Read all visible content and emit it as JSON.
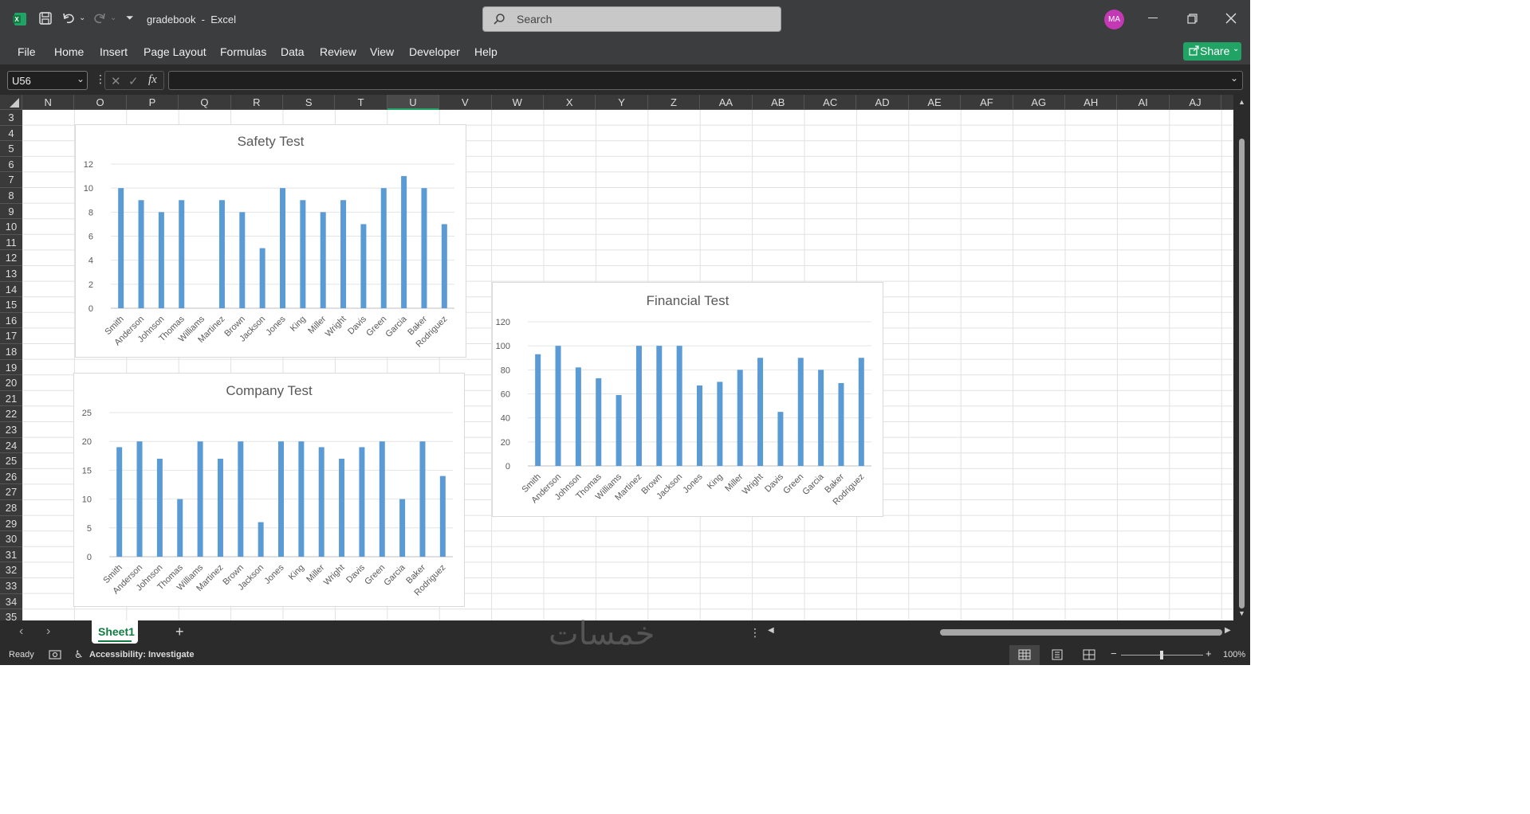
{
  "titlebar": {
    "doc_title": "gradebook  -  Excel",
    "search_placeholder": "Search",
    "avatar_initials": "MA"
  },
  "ribbon": {
    "tabs": [
      "File",
      "Home",
      "Insert",
      "Page Layout",
      "Formulas",
      "Data",
      "Review",
      "View",
      "Developer",
      "Help"
    ],
    "share_label": "Share"
  },
  "formula_bar": {
    "name_box": "U56",
    "fx_label": "fx",
    "formula": ""
  },
  "columns": [
    "N",
    "O",
    "P",
    "Q",
    "R",
    "S",
    "T",
    "U",
    "V",
    "W",
    "X",
    "Y",
    "Z",
    "AA",
    "AB",
    "AC",
    "AD",
    "AE",
    "AF",
    "AG",
    "AH",
    "AI",
    "AJ"
  ],
  "selected_column": "U",
  "rows": [
    "3",
    "4",
    "5",
    "6",
    "7",
    "8",
    "9",
    "10",
    "11",
    "12",
    "13",
    "14",
    "15",
    "16",
    "17",
    "18",
    "19",
    "20",
    "21",
    "22",
    "23",
    "24",
    "25",
    "26",
    "27",
    "28",
    "29",
    "30",
    "31",
    "32",
    "33",
    "34",
    "35"
  ],
  "sheet_tabs": {
    "active": "Sheet1",
    "add": "+"
  },
  "status": {
    "ready": "Ready",
    "accessibility": "Accessibility: Investigate",
    "zoom": "100%"
  },
  "watermark": "خمسات",
  "colors": {
    "bar": "#5b9bd5",
    "accent": "#21a366",
    "avatar": "#c239b3"
  },
  "chart_data": [
    {
      "type": "bar",
      "title": "Safety Test",
      "categories": [
        "Smith",
        "Anderson",
        "Johnson",
        "Thomas",
        "Williams",
        "Martinez",
        "Brown",
        "Jackson",
        "Jones",
        "King",
        "Miller",
        "Wright",
        "Davis",
        "Green",
        "Garcia",
        "Baker",
        "Rodriguez"
      ],
      "values": [
        10,
        9,
        8,
        9,
        0,
        9,
        8,
        5,
        10,
        9,
        8,
        9,
        7,
        10,
        11,
        10,
        7
      ],
      "ylim": [
        0,
        12
      ],
      "yticks": [
        0,
        2,
        4,
        6,
        8,
        10,
        12
      ]
    },
    {
      "type": "bar",
      "title": "Company Test",
      "categories": [
        "Smith",
        "Anderson",
        "Johnson",
        "Thomas",
        "Williams",
        "Martinez",
        "Brown",
        "Jackson",
        "Jones",
        "King",
        "Miller",
        "Wright",
        "Davis",
        "Green",
        "Garcia",
        "Baker",
        "Rodriguez"
      ],
      "values": [
        19,
        20,
        17,
        10,
        20,
        17,
        20,
        6,
        20,
        20,
        19,
        17,
        19,
        20,
        10,
        20,
        14
      ],
      "ylim": [
        0,
        25
      ],
      "yticks": [
        0,
        5,
        10,
        15,
        20,
        25
      ]
    },
    {
      "type": "bar",
      "title": "Financial Test",
      "categories": [
        "Smith",
        "Anderson",
        "Johnson",
        "Thomas",
        "Williams",
        "Martinez",
        "Brown",
        "Jackson",
        "Jones",
        "King",
        "Miller",
        "Wright",
        "Davis",
        "Green",
        "Garcia",
        "Baker",
        "Rodriguez"
      ],
      "values": [
        93,
        100,
        82,
        73,
        59,
        100,
        100,
        100,
        67,
        70,
        80,
        90,
        45,
        90,
        80,
        69,
        90
      ],
      "ylim": [
        0,
        120
      ],
      "yticks": [
        0,
        20,
        40,
        60,
        80,
        100,
        120
      ]
    }
  ]
}
